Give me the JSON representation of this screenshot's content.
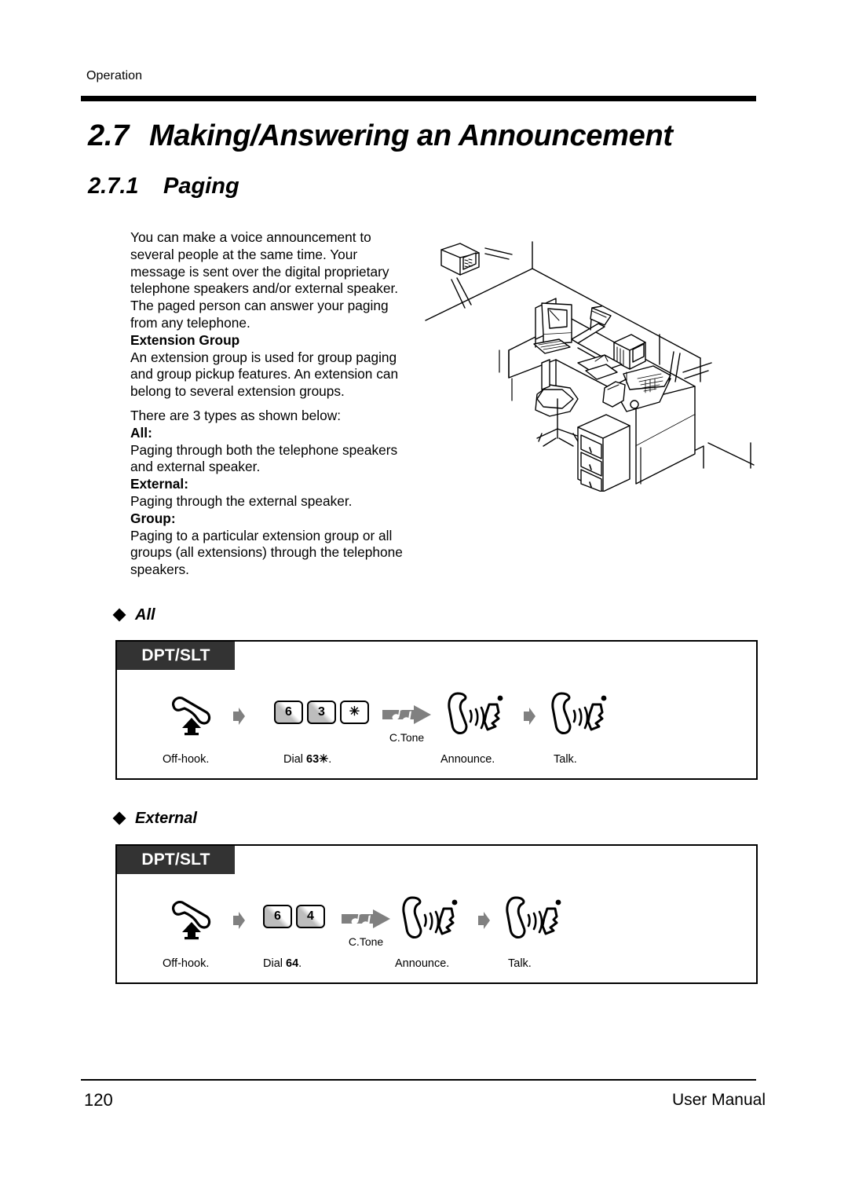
{
  "header": {
    "running_head": "Operation",
    "section_number": "2.7",
    "section_title": "Making/Answering an Announcement",
    "subsection_number": "2.7.1",
    "subsection_title": "Paging"
  },
  "body": {
    "intro": "You can make a voice announcement to several people at the same time. Your message is sent over the digital proprietary telephone speakers and/or external speaker. The paged person can answer your paging from any telephone.",
    "extension_group_heading": "Extension Group",
    "extension_group_text": "An extension group is used for group paging and group pickup features. An extension can belong to several extension groups.",
    "types_intro": "There are 3 types as shown below:",
    "types": [
      {
        "label": "All:",
        "description": "Paging through both the telephone speakers and external speaker."
      },
      {
        "label": "External:",
        "description": "Paging through the external speaker."
      },
      {
        "label": "Group:",
        "description": "Paging to a particular extension group or all groups (all extensions) through the telephone speakers."
      }
    ]
  },
  "illustration": {
    "name": "office-desk-with-wall-speaker-and-telephone",
    "elements": [
      "wall-speaker",
      "desk",
      "monitor",
      "keyboard",
      "desk-lamp",
      "papers",
      "telephone",
      "chair",
      "drawer-unit"
    ]
  },
  "procedures": [
    {
      "bullet_label": "All",
      "tab_label": "DPT/SLT",
      "steps": [
        {
          "icon": "off-hook-handset-icon",
          "caption": "Off-hook.",
          "caption_bold": "",
          "caption_tail": ""
        },
        {
          "icon": "keypad-keys",
          "keys": [
            "6",
            "3",
            "✳"
          ],
          "caption_prefix": "Dial ",
          "caption_bold": "63✳",
          "caption_tail": "."
        },
        {
          "icon": "confirmation-tone-icon",
          "tone_label": "C.Tone"
        },
        {
          "icon": "announce-handset-icon",
          "caption": "Announce."
        },
        {
          "icon": "talk-handset-icon",
          "caption": "Talk."
        }
      ]
    },
    {
      "bullet_label": "External",
      "tab_label": "DPT/SLT",
      "steps": [
        {
          "icon": "off-hook-handset-icon",
          "caption": "Off-hook."
        },
        {
          "icon": "keypad-keys",
          "keys": [
            "6",
            "4"
          ],
          "caption_prefix": "Dial ",
          "caption_bold": "64",
          "caption_tail": "."
        },
        {
          "icon": "confirmation-tone-icon",
          "tone_label": "C.Tone"
        },
        {
          "icon": "announce-handset-icon",
          "caption": "Announce."
        },
        {
          "icon": "talk-handset-icon",
          "caption": "Talk."
        }
      ]
    }
  ],
  "footer": {
    "page_number": "120",
    "manual_label": "User Manual"
  }
}
